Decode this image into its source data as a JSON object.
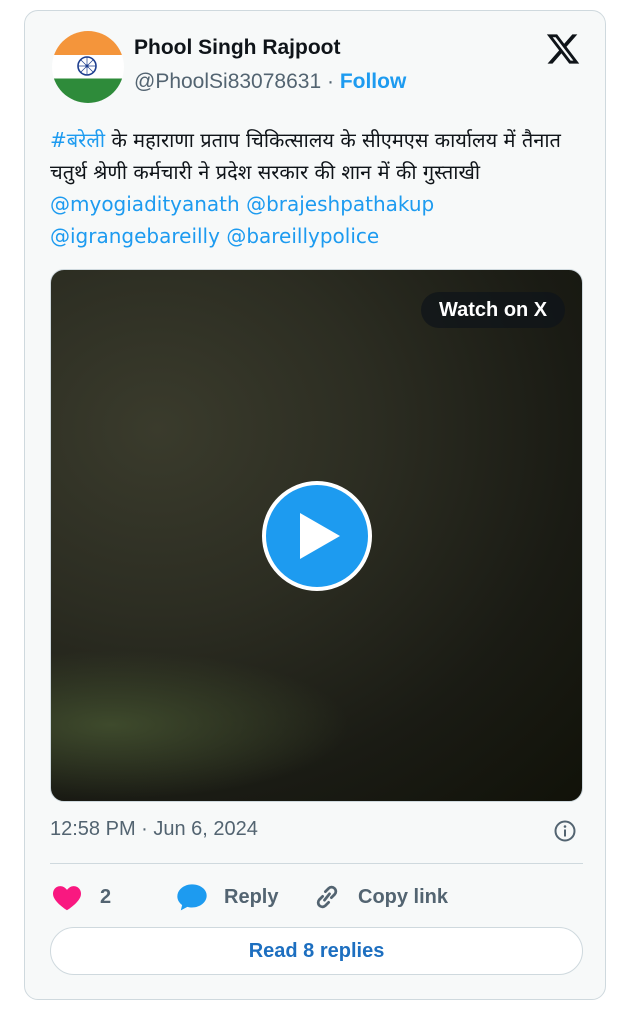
{
  "author": {
    "name": "Phool Singh Rajpoot",
    "handle": "@PhoolSi83078631",
    "separator": " · ",
    "follow_label": "Follow"
  },
  "icons": {
    "brand": "x-logo-icon",
    "play": "play-icon",
    "info": "info-icon",
    "like": "heart-icon",
    "reply": "speech-bubble-icon",
    "copy": "link-icon"
  },
  "tweet": {
    "hashtag": "#बरेली",
    "text": " के महाराणा प्रताप चिकित्सालय के सीएमएस कार्यालय में तैनात चतुर्थ श्रेणी कर्मचारी ने प्रदेश सरकार की शान में की गुस्ताखी ",
    "mentions": [
      "@myogiadityanath",
      "@brajeshpathakup",
      "@igrangebareilly",
      "@bareillypolice"
    ]
  },
  "media": {
    "watch_label": "Watch on X"
  },
  "meta": {
    "timestamp": "12:58 PM · Jun 6, 2024"
  },
  "actions": {
    "like_count": "2",
    "reply_label": "Reply",
    "copy_label": "Copy link"
  },
  "footer": {
    "read_replies_label": "Read 8 replies"
  },
  "colors": {
    "accent": "#1d9bf0",
    "like": "#f91880",
    "text_secondary": "#536471"
  }
}
